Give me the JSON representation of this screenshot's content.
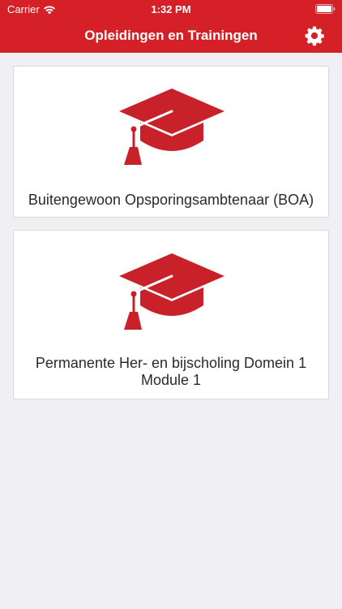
{
  "status": {
    "carrier": "Carrier",
    "time": "1:32 PM"
  },
  "nav": {
    "title": "Opleidingen en Trainingen",
    "settings_icon": "gear-icon"
  },
  "courses": [
    {
      "title": "Buitengewoon Opsporingsambtenaar (BOA)",
      "icon": "graduation-cap-icon"
    },
    {
      "title": "Permanente Her- en bijscholing Domein 1 Module 1",
      "icon": "graduation-cap-icon"
    }
  ],
  "colors": {
    "brand": "#d42026",
    "background": "#efeff4",
    "card": "#ffffff",
    "text": "#2a2a2a"
  }
}
